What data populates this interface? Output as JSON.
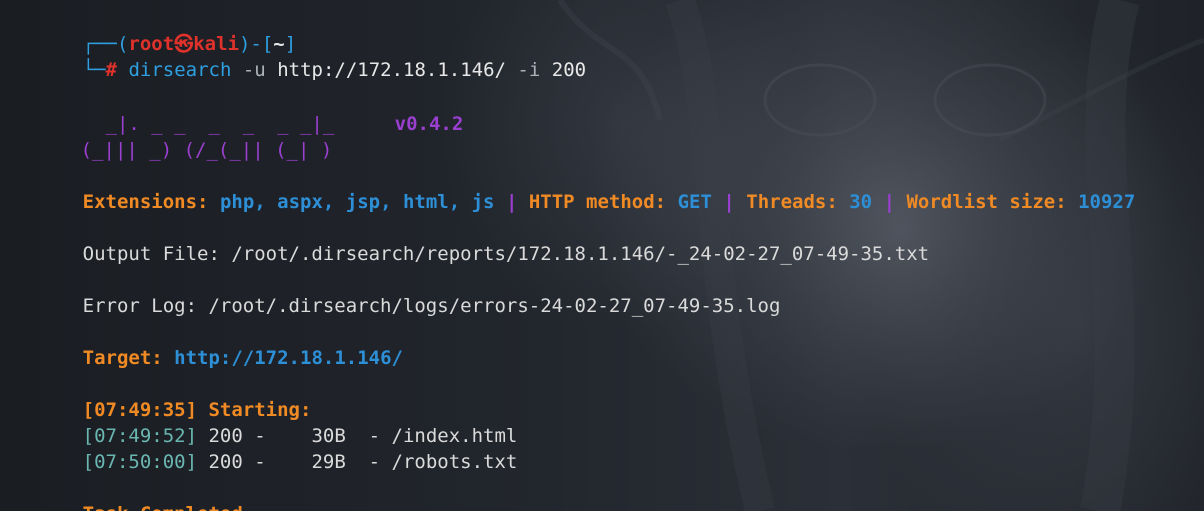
{
  "prompt": {
    "corner_top": "┌──",
    "open_paren": "(",
    "user": "root",
    "at_symbol": "㉿",
    "host": "kali",
    "close_bracket": ")-[",
    "cwd": "~",
    "close_cwd": "]",
    "corner_bottom": "└─",
    "hash": "#",
    "command": "dirsearch",
    "flag_u": "-u",
    "url": "http://172.18.1.146/",
    "flag_i": "-i",
    "status_filter": "200"
  },
  "banner": {
    "logo_line1": "  _|. _ _  _  _  _ _|_",
    "logo_line2": "(_||| _) (/_(_|| (_| )",
    "version": "v0.4.2"
  },
  "config": {
    "extensions_label": "Extensions:",
    "extensions_value": "php, aspx, jsp, html, js",
    "separator": "|",
    "method_label": "HTTP method:",
    "method_value": "GET",
    "threads_label": "Threads:",
    "threads_value": "30",
    "wordlist_label": "Wordlist size:",
    "wordlist_value": "10927"
  },
  "output_file": "Output File: /root/.dirsearch/reports/172.18.1.146/-_24-02-27_07-49-35.txt",
  "error_log": "Error Log: /root/.dirsearch/logs/errors-24-02-27_07-49-35.log",
  "target": {
    "label": "Target:",
    "value": "http://172.18.1.146/"
  },
  "starting": "[07:49:35] Starting:",
  "results": [
    {
      "time": "[07:49:52]",
      "status": "200",
      "size": "30B",
      "path": "/index.html"
    },
    {
      "time": "[07:50:00]",
      "status": "200",
      "size": "29B",
      "path": "/robots.txt"
    }
  ],
  "completed": "Task Completed",
  "colors": {
    "orange": "#f08a24",
    "blue": "#2d8fd6",
    "purple": "#9b3fd0",
    "red": "#e0312b",
    "teal": "#6ab6b0"
  }
}
